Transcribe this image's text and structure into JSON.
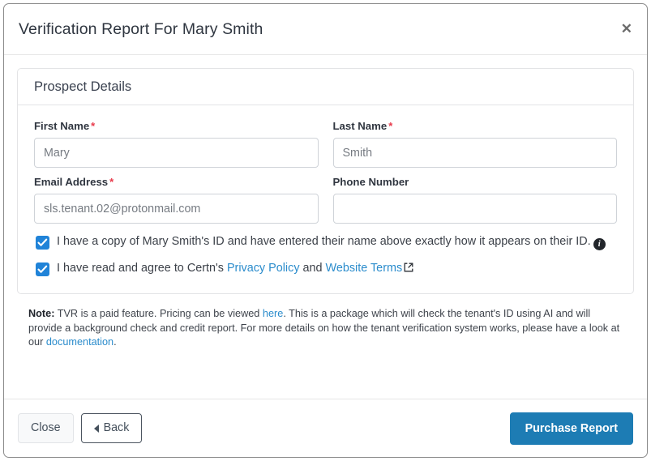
{
  "modal": {
    "title": "Verification Report For Mary Smith",
    "close_icon": "close-icon"
  },
  "panel": {
    "heading": "Prospect Details",
    "fields": {
      "first_name": {
        "label": "First Name",
        "required_marker": "*",
        "value": "Mary",
        "placeholder": "Mary"
      },
      "last_name": {
        "label": "Last Name",
        "required_marker": "*",
        "value": "Smith",
        "placeholder": "Smith"
      },
      "email": {
        "label": "Email Address",
        "required_marker": "*",
        "value": "sls.tenant.02@protonmail.com",
        "placeholder": "sls.tenant.02@protonmail.com"
      },
      "phone": {
        "label": "Phone Number",
        "required_marker": "",
        "value": "",
        "placeholder": ""
      }
    },
    "checkboxes": {
      "id_copy": {
        "checked": true,
        "text": "I have a copy of Mary Smith's ID and have entered their name above exactly how it appears on their ID.",
        "info_icon": "info-icon"
      },
      "terms": {
        "checked": true,
        "text_before": "I have read and agree to Certn's",
        "privacy_link": "Privacy Policy",
        "text_middle": "and",
        "terms_link": "Website Terms",
        "external_icon": "external-link-icon"
      }
    }
  },
  "note": {
    "label": "Note:",
    "part1": "TVR is a paid feature. Pricing can be viewed",
    "link1": "here",
    "part2": ". This is a package which will check the tenant's ID using AI and will provide a background check and credit report. For more details on how the tenant verification system works, please have a look at our",
    "link2": "documentation",
    "part3": "."
  },
  "footer": {
    "close_label": "Close",
    "back_label": "Back",
    "back_icon": "caret-left-icon",
    "purchase_label": "Purchase Report"
  },
  "colors": {
    "primary": "#1d7cb4",
    "link": "#2b8ccc",
    "checkbox": "#2083d8",
    "required": "#e8394a"
  }
}
